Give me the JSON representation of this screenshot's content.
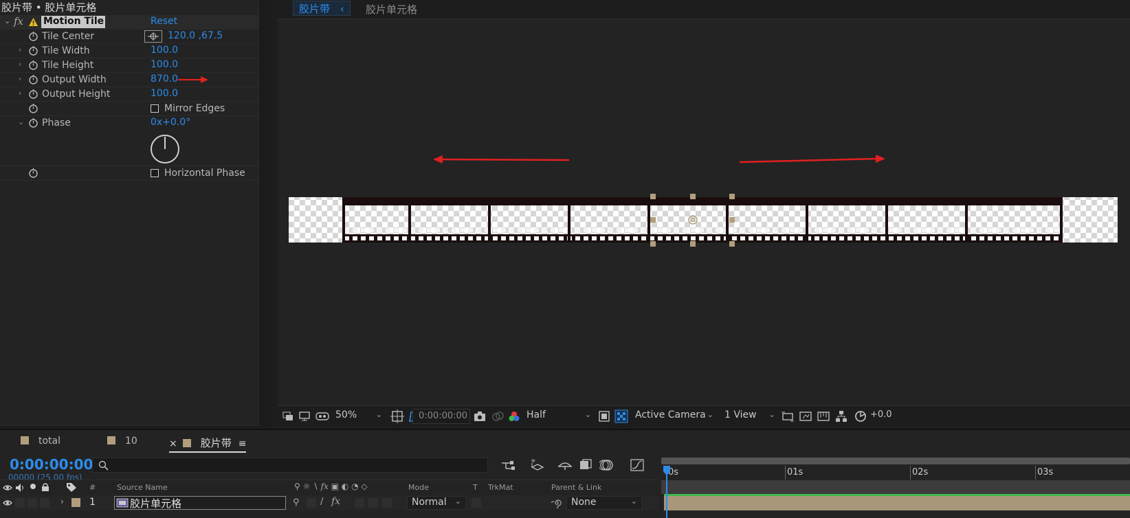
{
  "effects_panel": {
    "title": "胶片带 • 胶片单元格",
    "effect": {
      "fx_label": "fx",
      "name": "Motion Tile",
      "reset": "Reset",
      "properties": [
        {
          "name": "Tile Center",
          "value": "120.0 ,67.5"
        },
        {
          "name": "Tile Width",
          "value": "100.0"
        },
        {
          "name": "Tile Height",
          "value": "100.0"
        },
        {
          "name": "Output Width",
          "value": "870.0"
        },
        {
          "name": "Output Height",
          "value": "100.0"
        },
        {
          "name": "",
          "checkbox": "Mirror Edges"
        },
        {
          "name": "Phase",
          "value": "0x+0.0°"
        },
        {
          "name": "",
          "checkbox": "Horizontal Phase"
        }
      ]
    }
  },
  "viewer": {
    "tabs": [
      "胶片带",
      "胶片单元格"
    ],
    "toolbar": {
      "zoom": "50%",
      "timecode": "0:00:00:00",
      "resolution": "Half",
      "camera": "Active Camera",
      "views": "1 View",
      "exposure": "+0.0"
    }
  },
  "timeline": {
    "tabs": [
      "total",
      "10",
      "胶片带"
    ],
    "close_glyph": "×",
    "menu_glyph": "≡",
    "current_time": "0:00:00:00",
    "frame_info": "00000 (25.00 fps)",
    "columns": {
      "number": "#",
      "source_name": "Source Name",
      "mode": "Mode",
      "t": "T",
      "trkmat": "TrkMat",
      "parent": "Parent & Link"
    },
    "ruler": [
      "0s",
      "01s",
      "02s",
      "03s"
    ],
    "layers": [
      {
        "number": "1",
        "name": "胶片单元格",
        "mode": "Normal",
        "parent": "None"
      }
    ]
  },
  "colors": {
    "accent": "#2d8ceb",
    "label": "#b29e7d",
    "annotation": "#e02020"
  }
}
